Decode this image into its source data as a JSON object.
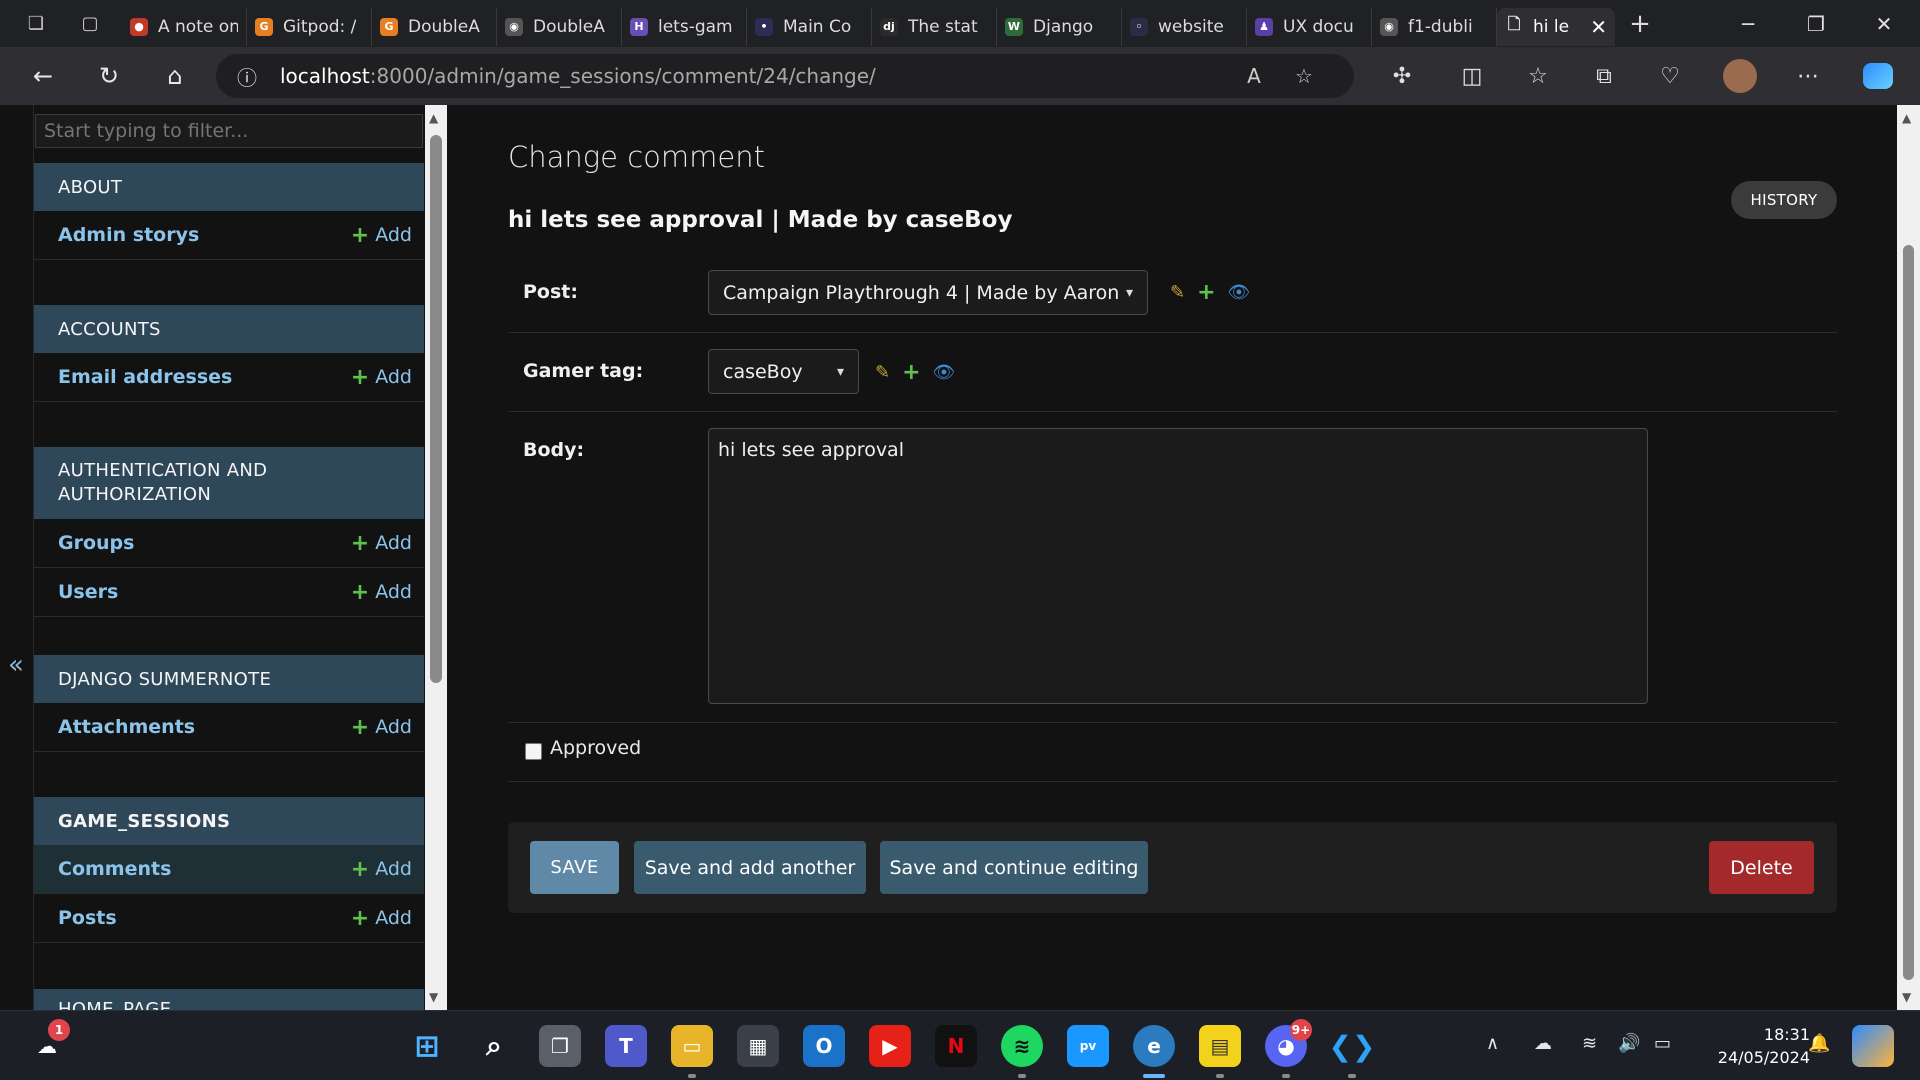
{
  "browser": {
    "tabs": [
      {
        "title": "A note on",
        "color": "#c0392b",
        "glyph": "●"
      },
      {
        "title": "Gitpod: /",
        "color": "#e67e22",
        "glyph": "G"
      },
      {
        "title": "DoubleA",
        "color": "#e67e22",
        "glyph": "G"
      },
      {
        "title": "DoubleA",
        "color": "#555555",
        "glyph": "◉"
      },
      {
        "title": "lets-gam",
        "color": "#6a4fb3",
        "glyph": "H"
      },
      {
        "title": "Main Co",
        "color": "#2c2c54",
        "glyph": "•"
      },
      {
        "title": "The stat",
        "color": "#2b2b2b",
        "glyph": "dj"
      },
      {
        "title": "Django",
        "color": "#2f6b3a",
        "glyph": "W"
      },
      {
        "title": "website",
        "color": "#2b2b44",
        "glyph": "◦"
      },
      {
        "title": "UX docu",
        "color": "#5b3fa8",
        "glyph": "♟"
      },
      {
        "title": "f1-dubli",
        "color": "#555555",
        "glyph": "◉"
      }
    ],
    "active_tab": {
      "title": "hi le",
      "close": "✕"
    },
    "new_tab": "+",
    "url_host": "localhost",
    "url_rest": ":8000/admin/game_sessions/comment/24/change/"
  },
  "sidebar": {
    "filter_placeholder": "Start typing to filter...",
    "add_label": "Add",
    "modules": [
      {
        "caption": "ABOUT",
        "items": [
          {
            "label": "Admin storys"
          }
        ]
      },
      {
        "caption": "ACCOUNTS",
        "items": [
          {
            "label": "Email addresses"
          }
        ]
      },
      {
        "caption": "AUTHENTICATION AND AUTHORIZATION",
        "items": [
          {
            "label": "Groups"
          },
          {
            "label": "Users"
          }
        ]
      },
      {
        "caption": "DJANGO SUMMERNOTE",
        "items": [
          {
            "label": "Attachments"
          }
        ]
      },
      {
        "caption": "GAME_SESSIONS",
        "items": [
          {
            "label": "Comments"
          },
          {
            "label": "Posts"
          }
        ]
      },
      {
        "caption": "HOME_PAGE",
        "items": []
      }
    ],
    "collapse_glyph": "«"
  },
  "main": {
    "page_title": "Change comment",
    "history_label": "HISTORY",
    "object_title": "hi lets see approval | Made by caseBoy",
    "fields": {
      "post_label": "Post:",
      "post_value": "Campaign Playthrough 4 | Made by Aaron",
      "gamer_tag_label": "Gamer tag:",
      "gamer_tag_value": "caseBoy",
      "body_label": "Body:",
      "body_value": "hi lets see approval",
      "approved_label": "Approved",
      "approved_checked": false
    },
    "buttons": {
      "save": "SAVE",
      "save_add_another": "Save and add another",
      "save_continue": "Save and continue editing",
      "delete": "Delete"
    }
  },
  "taskbar": {
    "time": "18:31",
    "date": "24/05/2024",
    "weather_badge": "1",
    "discord_badge": "9+"
  },
  "colors": {
    "module_caption_bg": "#2e4759",
    "link": "#8bc3ea",
    "add_plus": "#5ec24b",
    "save_button": "#5f89a6",
    "secondary_button": "#3a5a6e",
    "delete_button": "#a3292b"
  }
}
